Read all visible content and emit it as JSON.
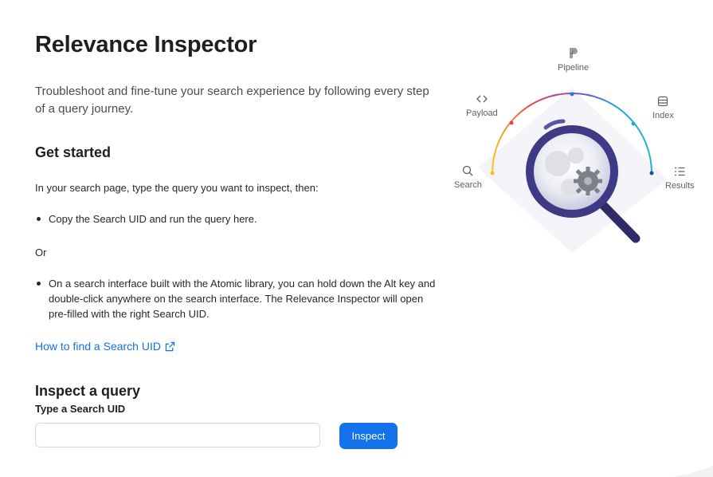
{
  "header": {
    "title": "Relevance Inspector"
  },
  "intro": "Troubleshoot and fine-tune your search experience by following every step of a query journey.",
  "get_started": {
    "heading": "Get started",
    "instruction": "In your search page, type the query you want to inspect, then:",
    "bullet1": "Copy the Search UID and run the query here.",
    "or": "Or",
    "bullet2": "On a search interface built with the Atomic library, you can hold down the Alt key and double-click anywhere on the search interface. The Relevance Inspector will open pre-filled with the right Search UID.",
    "link": "How to find a Search UID"
  },
  "inspect": {
    "heading": "Inspect a query",
    "label": "Type a Search UID",
    "input_value": "",
    "input_placeholder": "",
    "button": "Inspect"
  },
  "illustration": {
    "steps": [
      "Pipeline",
      "Payload",
      "Index",
      "Search",
      "Results"
    ],
    "icons": [
      "pipeline-icon",
      "code-icon",
      "database-icon",
      "search-icon",
      "list-icon"
    ],
    "arc_colors": [
      "#f5c518",
      "#e8424e",
      "#7a4ce0",
      "#1fa8d8",
      "#1fb5c9"
    ],
    "magnifier_color": "#3e3a85"
  }
}
